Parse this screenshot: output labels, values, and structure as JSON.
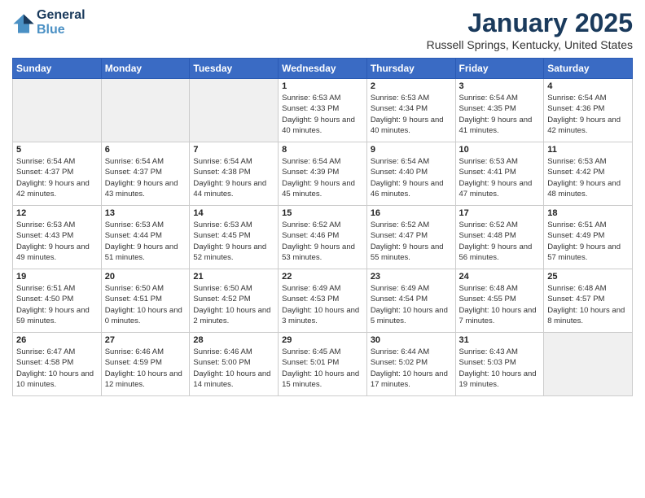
{
  "logo": {
    "line1": "General",
    "line2": "Blue"
  },
  "title": "January 2025",
  "location": "Russell Springs, Kentucky, United States",
  "days_header": [
    "Sunday",
    "Monday",
    "Tuesday",
    "Wednesday",
    "Thursday",
    "Friday",
    "Saturday"
  ],
  "weeks": [
    [
      {
        "day": "",
        "empty": true
      },
      {
        "day": "",
        "empty": true
      },
      {
        "day": "",
        "empty": true
      },
      {
        "day": "1",
        "sunrise": "6:53 AM",
        "sunset": "4:33 PM",
        "daylight": "9 hours and 40 minutes."
      },
      {
        "day": "2",
        "sunrise": "6:53 AM",
        "sunset": "4:34 PM",
        "daylight": "9 hours and 40 minutes."
      },
      {
        "day": "3",
        "sunrise": "6:54 AM",
        "sunset": "4:35 PM",
        "daylight": "9 hours and 41 minutes."
      },
      {
        "day": "4",
        "sunrise": "6:54 AM",
        "sunset": "4:36 PM",
        "daylight": "9 hours and 42 minutes."
      }
    ],
    [
      {
        "day": "5",
        "sunrise": "6:54 AM",
        "sunset": "4:37 PM",
        "daylight": "9 hours and 42 minutes."
      },
      {
        "day": "6",
        "sunrise": "6:54 AM",
        "sunset": "4:37 PM",
        "daylight": "9 hours and 43 minutes."
      },
      {
        "day": "7",
        "sunrise": "6:54 AM",
        "sunset": "4:38 PM",
        "daylight": "9 hours and 44 minutes."
      },
      {
        "day": "8",
        "sunrise": "6:54 AM",
        "sunset": "4:39 PM",
        "daylight": "9 hours and 45 minutes."
      },
      {
        "day": "9",
        "sunrise": "6:54 AM",
        "sunset": "4:40 PM",
        "daylight": "9 hours and 46 minutes."
      },
      {
        "day": "10",
        "sunrise": "6:53 AM",
        "sunset": "4:41 PM",
        "daylight": "9 hours and 47 minutes."
      },
      {
        "day": "11",
        "sunrise": "6:53 AM",
        "sunset": "4:42 PM",
        "daylight": "9 hours and 48 minutes."
      }
    ],
    [
      {
        "day": "12",
        "sunrise": "6:53 AM",
        "sunset": "4:43 PM",
        "daylight": "9 hours and 49 minutes."
      },
      {
        "day": "13",
        "sunrise": "6:53 AM",
        "sunset": "4:44 PM",
        "daylight": "9 hours and 51 minutes."
      },
      {
        "day": "14",
        "sunrise": "6:53 AM",
        "sunset": "4:45 PM",
        "daylight": "9 hours and 52 minutes."
      },
      {
        "day": "15",
        "sunrise": "6:52 AM",
        "sunset": "4:46 PM",
        "daylight": "9 hours and 53 minutes."
      },
      {
        "day": "16",
        "sunrise": "6:52 AM",
        "sunset": "4:47 PM",
        "daylight": "9 hours and 55 minutes."
      },
      {
        "day": "17",
        "sunrise": "6:52 AM",
        "sunset": "4:48 PM",
        "daylight": "9 hours and 56 minutes."
      },
      {
        "day": "18",
        "sunrise": "6:51 AM",
        "sunset": "4:49 PM",
        "daylight": "9 hours and 57 minutes."
      }
    ],
    [
      {
        "day": "19",
        "sunrise": "6:51 AM",
        "sunset": "4:50 PM",
        "daylight": "9 hours and 59 minutes."
      },
      {
        "day": "20",
        "sunrise": "6:50 AM",
        "sunset": "4:51 PM",
        "daylight": "10 hours and 0 minutes."
      },
      {
        "day": "21",
        "sunrise": "6:50 AM",
        "sunset": "4:52 PM",
        "daylight": "10 hours and 2 minutes."
      },
      {
        "day": "22",
        "sunrise": "6:49 AM",
        "sunset": "4:53 PM",
        "daylight": "10 hours and 3 minutes."
      },
      {
        "day": "23",
        "sunrise": "6:49 AM",
        "sunset": "4:54 PM",
        "daylight": "10 hours and 5 minutes."
      },
      {
        "day": "24",
        "sunrise": "6:48 AM",
        "sunset": "4:55 PM",
        "daylight": "10 hours and 7 minutes."
      },
      {
        "day": "25",
        "sunrise": "6:48 AM",
        "sunset": "4:57 PM",
        "daylight": "10 hours and 8 minutes."
      }
    ],
    [
      {
        "day": "26",
        "sunrise": "6:47 AM",
        "sunset": "4:58 PM",
        "daylight": "10 hours and 10 minutes."
      },
      {
        "day": "27",
        "sunrise": "6:46 AM",
        "sunset": "4:59 PM",
        "daylight": "10 hours and 12 minutes."
      },
      {
        "day": "28",
        "sunrise": "6:46 AM",
        "sunset": "5:00 PM",
        "daylight": "10 hours and 14 minutes."
      },
      {
        "day": "29",
        "sunrise": "6:45 AM",
        "sunset": "5:01 PM",
        "daylight": "10 hours and 15 minutes."
      },
      {
        "day": "30",
        "sunrise": "6:44 AM",
        "sunset": "5:02 PM",
        "daylight": "10 hours and 17 minutes."
      },
      {
        "day": "31",
        "sunrise": "6:43 AM",
        "sunset": "5:03 PM",
        "daylight": "10 hours and 19 minutes."
      },
      {
        "day": "",
        "empty": true
      }
    ]
  ]
}
